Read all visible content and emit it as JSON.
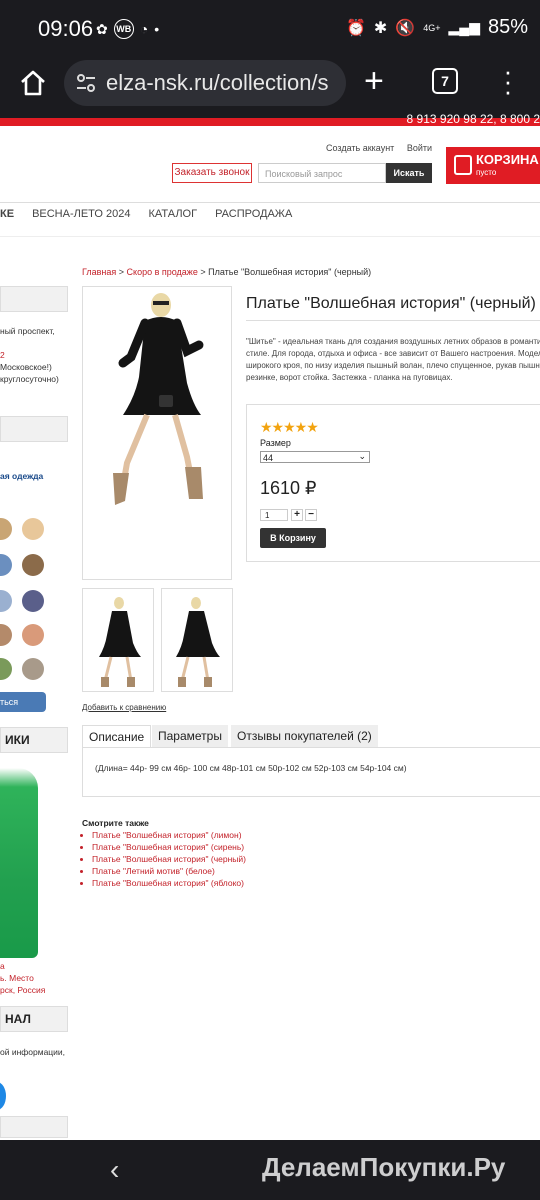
{
  "status_bar": {
    "time": "09:06",
    "wb_label": "WB",
    "network": "4G+",
    "battery": "85%"
  },
  "browser": {
    "url": "elza-nsk.ru/collection/s",
    "tab_count": "7"
  },
  "header": {
    "phone": "8 913 920 98 22, 8 800 2",
    "create_account": "Создать аккаунт",
    "login": "Войти",
    "order_call": "Заказать звонок",
    "search_placeholder": "Поисковый запрос",
    "search_button": "Искать",
    "cart_title": "КОРЗИНА:",
    "cart_status": "пусто"
  },
  "nav": [
    "КЕ",
    "ВЕСНА-ЛЕТО 2024",
    "КАТАЛОГ",
    "РАСПРОДАЖА"
  ],
  "sidebar": {
    "address_lines": [
      "ный проспект,",
      "",
      "2",
      "Московское!)",
      "круглосуточно)"
    ],
    "category_link": "ая одежда",
    "avatar_button": "ться",
    "section_title_1": "ИКИ",
    "product_caption": [
      "а",
      "ь. Место",
      "рск, Россия"
    ],
    "section_title_2": "НАЛ",
    "info_text": "ой информации,"
  },
  "breadcrumb": {
    "home": "Главная",
    "sep": " > ",
    "section": "Скоро в продаже",
    "current": "Платье \"Волшебная история\" (черный)"
  },
  "product": {
    "title": "Платье \"Волшебная история\" (черный)",
    "description": [
      "\"Шитье\" - идеальная ткань для создания воздушных летних образов в романти",
      "стиле. Для города, отдыха и офиса - все зависит от Вашего настроения. Модел",
      "широкого кроя, по низу изделия пышный волан, плечо спущенное, рукав пышн",
      "резинке, ворот стойка. Застежка - планка на пуговицах."
    ],
    "rating_stars": "★★★★★",
    "rating_value": 5,
    "size_label": "Размер",
    "size_selected": "44",
    "price": "1610 ₽",
    "quantity": "1",
    "plus": "+",
    "minus": "−",
    "add_to_cart": "В Корзину",
    "compare_link": "Добавить к сравнению"
  },
  "tabs": [
    {
      "label": "Описание",
      "active": true
    },
    {
      "label": "Параметры",
      "active": false
    },
    {
      "label": "Отзывы покупателей (2)",
      "active": false
    }
  ],
  "tab_content": "(Длина=  44р- 99 см   46р- 100 см   48р-101 см   50р-102 см   52р-103 см   54р-104 см)",
  "see_also": {
    "title": "Смотрите также",
    "items": [
      "Платье \"Волшебная история\" (лимон)",
      "Платье \"Волшебная история\" (сирень)",
      "Платье \"Волшебная история\" (черный)",
      "Платье \"Летний мотив\" (белое)",
      "Платье \"Волшебная история\" (яблоко)"
    ]
  },
  "watermark": "ДелаемПокупки.Ру",
  "colors": {
    "accent": "#e01c24",
    "link": "#c3222a",
    "star": "#f2a30f",
    "dark_ui": "#1b1b1f"
  }
}
